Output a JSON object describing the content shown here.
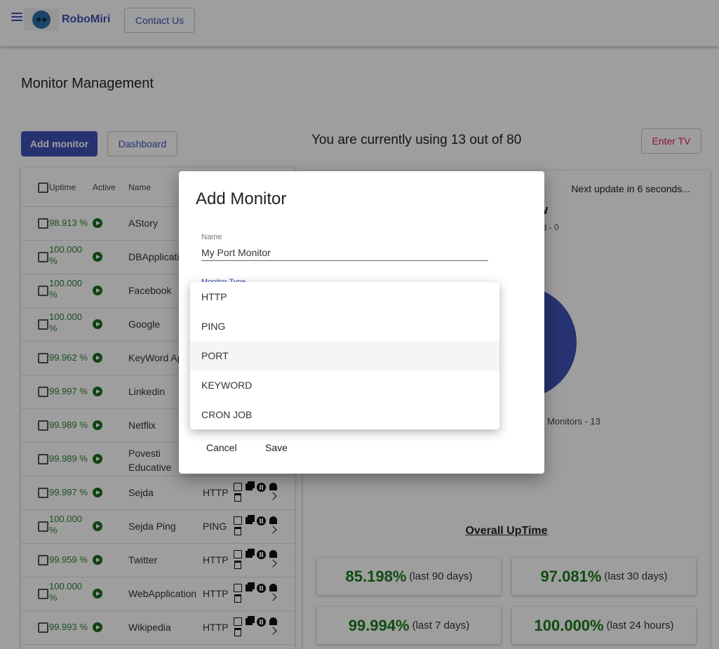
{
  "header": {
    "brand": "RoboMiri",
    "contact_label": "Contact Us"
  },
  "page": {
    "title": "Monitor Management",
    "add_label": "Add monitor",
    "dashboard_label": "Dashboard",
    "usage_text": "You are currently using 13 out of 80",
    "tv_label": "Enter TV"
  },
  "table": {
    "headers": {
      "uptime": "Uptime",
      "active": "Active",
      "name": "Name"
    },
    "rows": [
      {
        "uptime": "98.913 %",
        "name": "AStory",
        "type": ""
      },
      {
        "uptime": "100.000 %",
        "name": "DBApplicati",
        "type": ""
      },
      {
        "uptime": "100.000 %",
        "name": "Facebook",
        "type": ""
      },
      {
        "uptime": "100.000 %",
        "name": "Google",
        "type": ""
      },
      {
        "uptime": "99.962 %",
        "name": "KeyWord Ap",
        "type": ""
      },
      {
        "uptime": "99.997 %",
        "name": "Linkedin",
        "type": ""
      },
      {
        "uptime": "99.989 %",
        "name": "Netflix",
        "type": ""
      },
      {
        "uptime": "99.989 %",
        "name": "Povesti Educative",
        "type": ""
      },
      {
        "uptime": "99.997 %",
        "name": "Sejda",
        "type": "HTTP"
      },
      {
        "uptime": "100.000 %",
        "name": "Sejda Ping",
        "type": "PING"
      },
      {
        "uptime": "99.959 %",
        "name": "Twitter",
        "type": "HTTP"
      },
      {
        "uptime": "100.000 %",
        "name": "WebApplication",
        "type": "HTTP"
      },
      {
        "uptime": "99.993 %",
        "name": "Wikipedia",
        "type": "HTTP"
      }
    ]
  },
  "overview": {
    "next_update": "Next update in 6 seconds...",
    "title_fragment": "iew",
    "paused_fragment": "sed - 0",
    "legend_fragment": "ng Monitors - 13",
    "overall_label": "Overall UpTime",
    "stats": [
      {
        "pct": "85.198%",
        "period": "(last 90 days)"
      },
      {
        "pct": "97.081%",
        "period": "(last 30 days)"
      },
      {
        "pct": "99.994%",
        "period": "(last 7 days)"
      },
      {
        "pct": "100.000%",
        "period": "(last 24 hours)"
      }
    ],
    "pie_color": "#3f51b5"
  },
  "dialog": {
    "title": "Add Monitor",
    "name_label": "Name",
    "name_value": "My Port Monitor",
    "type_label": "Monitor Type",
    "cancel_label": "Cancel",
    "save_label": "Save",
    "options": [
      "HTTP",
      "PING",
      "PORT",
      "KEYWORD",
      "CRON JOB"
    ],
    "selected_option": "PORT"
  },
  "colors": {
    "primary": "#3f51b5",
    "accent": "#e91e63",
    "uptime_green": "#2e7d32"
  }
}
